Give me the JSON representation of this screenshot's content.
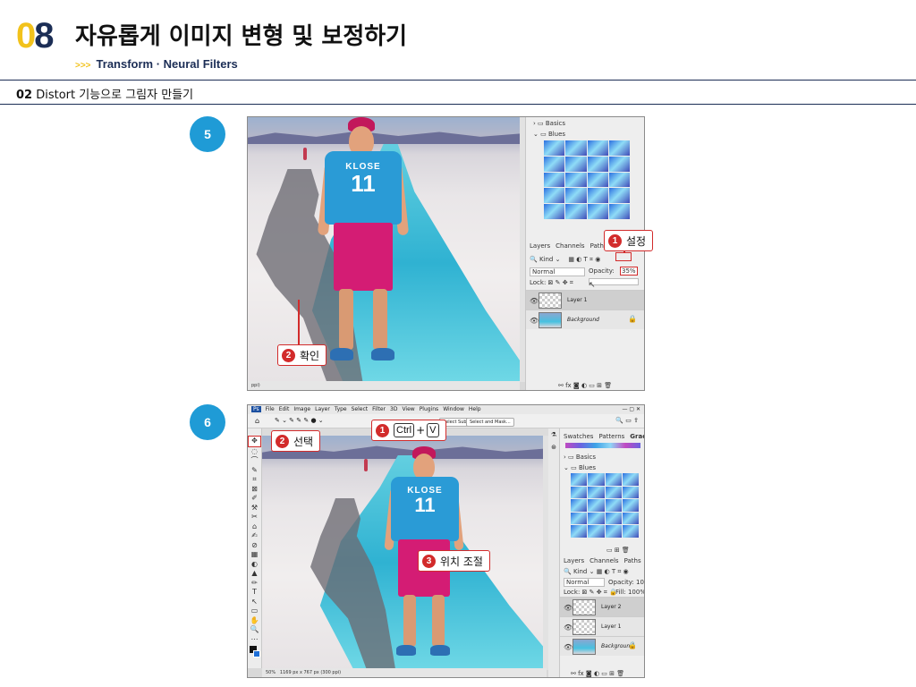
{
  "header": {
    "chapter_first": "0",
    "chapter_second": "8",
    "title": "자유롭게 이미지 변형 및 보정하기",
    "sub_arrows": ">>>",
    "subtitle": "Transform · Neural Filters"
  },
  "section": {
    "number": "02",
    "label": "Distort 기능으로 그림자 만들기"
  },
  "colors": {
    "accent_yellow": "#f2c21b",
    "navy": "#1b2d55",
    "step_blue": "#1f9bd6",
    "callout_red": "#d22b2b"
  },
  "step5": {
    "badge": "5",
    "panel": {
      "folder_basics": "Basics",
      "folder_blues": "Blues",
      "tabs": [
        "Layers",
        "Channels",
        "Paths"
      ],
      "kind_label": "Kind",
      "blend_mode": "Normal",
      "opacity_label": "Opacity:",
      "opacity_value": "35%",
      "lock_label": "Lock:",
      "layers": [
        {
          "name": "Layer 1",
          "selected": true
        },
        {
          "name": "Background",
          "selected": false
        }
      ]
    },
    "shirt_name": "KLOSE",
    "shirt_number": "11",
    "status_text": "ppi)",
    "callout1_number": "1",
    "callout1_text": "설정",
    "callout2_number": "2",
    "callout2_text": "확인"
  },
  "step6": {
    "badge": "6",
    "menu": [
      "File",
      "Edit",
      "Image",
      "Layer",
      "Type",
      "Select",
      "Filter",
      "3D",
      "View",
      "Plugins",
      "Window",
      "Help"
    ],
    "opt_button_subject": "Select Subject",
    "opt_button_mask": "Select and Mask...",
    "tool_icons": [
      "✥",
      "◌",
      "⌒",
      "✎",
      "⌗",
      "⊠",
      "✐",
      "⚒",
      "✂",
      "⌂",
      "✍",
      "⊘",
      "▦",
      "◐",
      "▲",
      "✏",
      "T",
      "↖",
      "▭",
      "✋",
      "🔍",
      "⋯"
    ],
    "panel": {
      "tabs_top": [
        "Swatches",
        "Patterns",
        "Gradients"
      ],
      "folder_basics": "Basics",
      "folder_blues": "Blues",
      "tabs": [
        "Layers",
        "Channels",
        "Paths"
      ],
      "kind_label": "Kind",
      "blend_mode": "Normal",
      "opacity_label": "Opacity:",
      "opacity_value": "100%",
      "lock_label": "Lock:",
      "fill_label": "Fill:",
      "fill_value": "100%",
      "layers": [
        {
          "name": "Layer 2",
          "selected": true
        },
        {
          "name": "Layer 1",
          "selected": false
        },
        {
          "name": "Background",
          "selected": false
        }
      ]
    },
    "zoom": "50%",
    "doc_size": "1169 px x 767 px (300 ppi)",
    "shirt_name": "KLOSE",
    "shirt_number": "11",
    "callout1_number": "1",
    "callout1_key1": "Ctrl",
    "callout1_plus": "+",
    "callout1_key2": "V",
    "callout2_number": "2",
    "callout2_text": "선택",
    "callout3_number": "3",
    "callout3_text": "위치 조절"
  }
}
